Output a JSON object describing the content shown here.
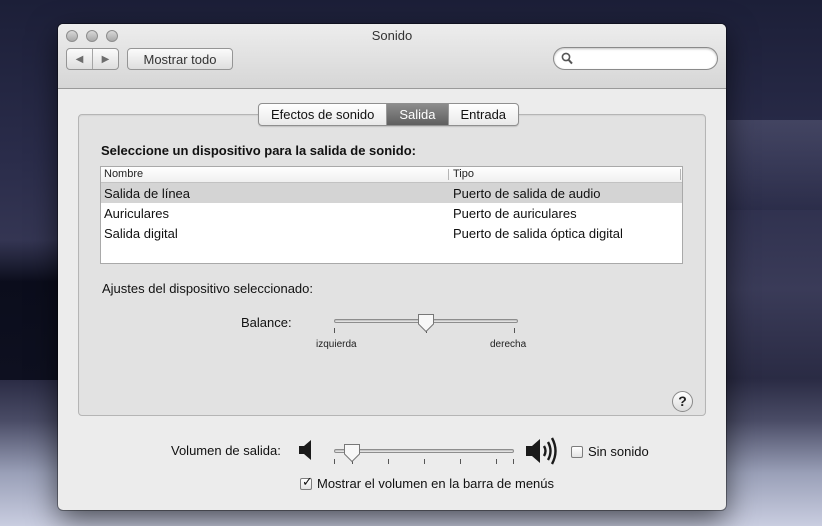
{
  "window": {
    "title": "Sonido"
  },
  "toolbar": {
    "back_glyph": "◀",
    "forward_glyph": "▶",
    "show_all_label": "Mostrar todo",
    "search_placeholder": "",
    "search_value": ""
  },
  "tabs": [
    {
      "label": "Efectos de sonido",
      "active": false
    },
    {
      "label": "Salida",
      "active": true
    },
    {
      "label": "Entrada",
      "active": false
    }
  ],
  "output": {
    "section_label": "Seleccione un dispositivo para la salida de sonido:",
    "columns": [
      "Nombre",
      "Tipo"
    ],
    "devices": [
      {
        "name": "Salida de línea",
        "type": "Puerto de salida de audio",
        "selected": true
      },
      {
        "name": "Auriculares",
        "type": "Puerto de auriculares",
        "selected": false
      },
      {
        "name": "Salida digital",
        "type": "Puerto de salida óptica digital",
        "selected": false
      }
    ],
    "settings_label": "Ajustes del dispositivo seleccionado:",
    "balance": {
      "label": "Balance:",
      "left_label": "izquierda",
      "right_label": "derecha",
      "value": 0.5
    },
    "help_glyph": "?"
  },
  "volume": {
    "label": "Volumen de salida:",
    "value": 0.1,
    "mute_label": "Sin sonido",
    "mute_checked": false,
    "show_in_menubar_label": "Mostrar el volumen en la barra de menús",
    "show_in_menubar_checked": true,
    "check_glyph": "✓"
  },
  "colors": {
    "selected_row": "#d4d4d4",
    "active_tab": "#6f6f6f"
  }
}
